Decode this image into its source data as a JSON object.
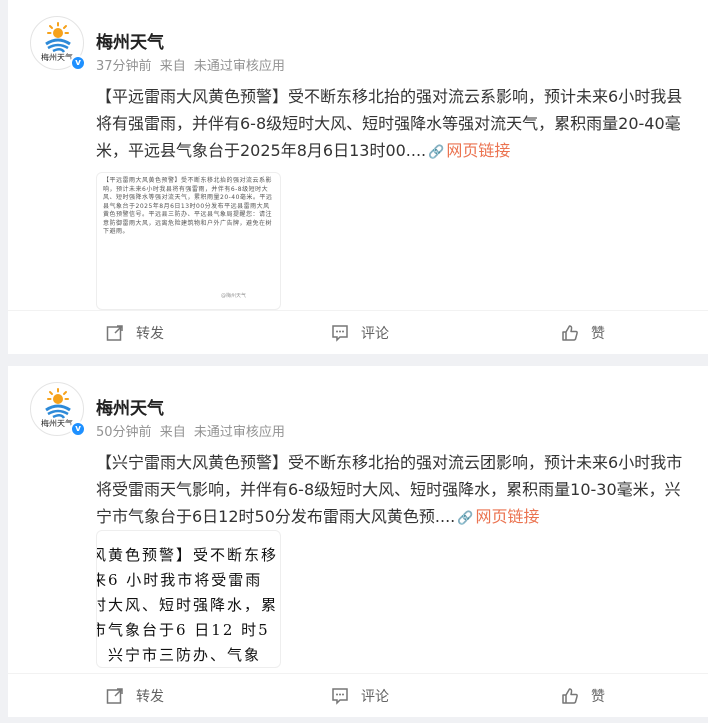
{
  "colors": {
    "link": "#eb7350",
    "verify": "#1e90ff",
    "meta": "#939393"
  },
  "posts": [
    {
      "author": "梅州天气",
      "avatar_caption": "梅州天气",
      "time": "37分钟前",
      "source_prefix": "来自",
      "source": "未通过审核应用",
      "topic": "【平远雷雨大风黄色预警】",
      "body": "受不断东移北抬的强对流云系影响，预计未来6小时我县将有强雷雨，并伴有6-8级短时大风、短时强降水等强对流天气，累积雨量20-40毫米，平远县气象台于2025年8月6日13时00....",
      "link_label": "网页链接",
      "thumb_text": "【平远雷雨大风黄色预警】受不断东移北抬的强对流云系影响，预计未来6小时我县将有强雷雨，并伴有6-8级短时大风、短时强降水等强对流天气，累积雨量20-40毫米。平远县气象台于2025年8月6日13时00分发布平远县雷雨大风黄色预警信号。平远县三防办、平远县气象局提醒您：请注意防御雷雨大风，远离危险建筑物和户外广告牌，避免在树下避雨。",
      "thumb_wm": "@梅州天气",
      "actions": {
        "repost": "转发",
        "comment": "评论",
        "like": "赞"
      }
    },
    {
      "author": "梅州天气",
      "avatar_caption": "梅州天气",
      "time": "50分钟前",
      "source_prefix": "来自",
      "source": "未通过审核应用",
      "topic": "【兴宁雷雨大风黄色预警】",
      "body": "受不断东移北抬的强对流云团影响，预计未来6小时我市将受雷雨天气影响，并伴有6-8级短时大风、短时强降水，累积雨量10-30毫米，兴宁市气象台于6日12时50分发布雷雨大风黄色预....",
      "link_label": "网页链接",
      "thumb_lines": [
        "风黄色预警】受不断东移",
        "来6 小时我市将受雷雨",
        "时大风、短时强降水，累",
        "市气象台于6 日12 时5",
        "，兴宁市三防办、气象"
      ],
      "actions": {
        "repost": "转发",
        "comment": "评论",
        "like": "赞"
      }
    }
  ]
}
